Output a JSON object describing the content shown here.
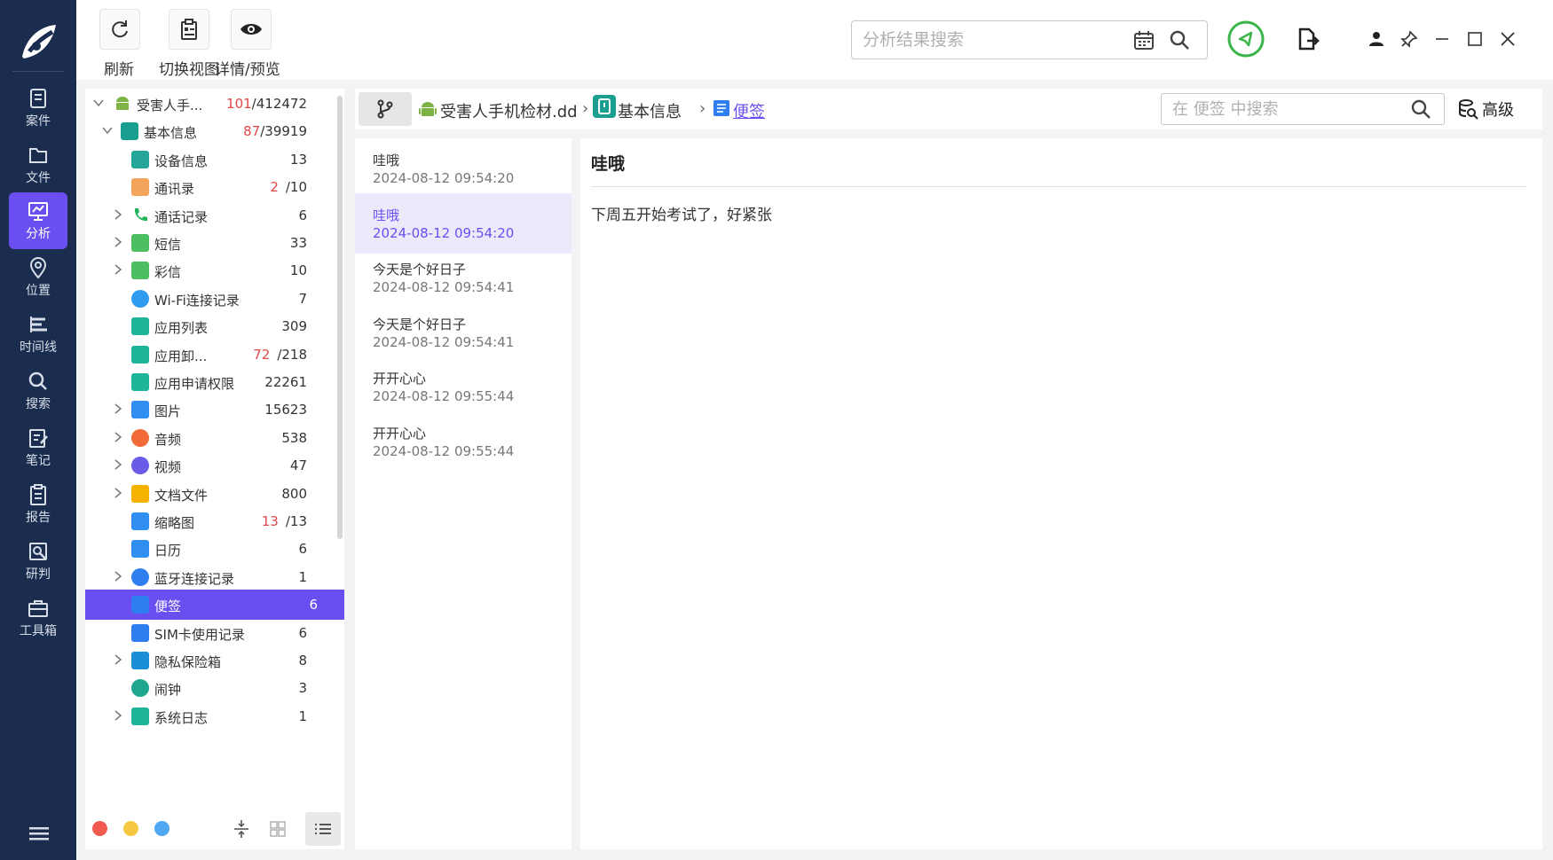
{
  "toolbar": {
    "refresh_label": "刷新",
    "switch_view_label": "切换视图",
    "details_label": "详情/预览",
    "search_placeholder": "分析结果搜索"
  },
  "nav": {
    "items": [
      {
        "label": "案件",
        "icon": "case-icon"
      },
      {
        "label": "文件",
        "icon": "folder-icon"
      },
      {
        "label": "分析",
        "icon": "analysis-icon",
        "active": true
      },
      {
        "label": "位置",
        "icon": "location-icon"
      },
      {
        "label": "时间线",
        "icon": "timeline-icon"
      },
      {
        "label": "搜索",
        "icon": "search-icon"
      },
      {
        "label": "笔记",
        "icon": "notes-icon"
      },
      {
        "label": "报告",
        "icon": "report-icon"
      },
      {
        "label": "研判",
        "icon": "judge-icon"
      },
      {
        "label": "工具箱",
        "icon": "toolbox-icon"
      }
    ]
  },
  "tree": {
    "rows": [
      {
        "name": "受害人手...",
        "red": "101",
        "total": "/412472",
        "icon": "android-icon",
        "color": "#7cb342"
      },
      {
        "name": "基本信息",
        "red": "87",
        "total": "/39919",
        "icon": "basic-info-icon",
        "color": "#1a9e8f"
      },
      {
        "name": "设备信息",
        "red": "",
        "total": "13",
        "icon": "device-info-icon",
        "color": "#26a69a"
      },
      {
        "name": "通讯录",
        "red": "2",
        "total": "/10",
        "icon": "contacts-icon",
        "color": "#f5a45b"
      },
      {
        "name": "通话记录",
        "red": "",
        "total": "6",
        "icon": "phone-icon",
        "color": "#21b35b"
      },
      {
        "name": "短信",
        "red": "",
        "total": "33",
        "icon": "sms-icon",
        "color": "#4cbf60"
      },
      {
        "name": "彩信",
        "red": "",
        "total": "10",
        "icon": "mms-icon",
        "color": "#4cbf60"
      },
      {
        "name": "Wi-Fi连接记录",
        "red": "",
        "total": "7",
        "icon": "wifi-icon",
        "color": "#2f9bf0"
      },
      {
        "name": "应用列表",
        "red": "",
        "total": "309",
        "icon": "app-list-icon",
        "color": "#1fb59a"
      },
      {
        "name": "应用卸...",
        "red": "72",
        "total": "/218",
        "icon": "app-uninstall-icon",
        "color": "#1fb59a"
      },
      {
        "name": "应用申请权限",
        "red": "",
        "total": "22261",
        "icon": "app-permission-icon",
        "color": "#1fb59a"
      },
      {
        "name": "图片",
        "red": "",
        "total": "15623",
        "icon": "image-icon",
        "color": "#2f8ef0"
      },
      {
        "name": "音频",
        "red": "",
        "total": "538",
        "icon": "audio-icon",
        "color": "#f06a3a"
      },
      {
        "name": "视频",
        "red": "",
        "total": "47",
        "icon": "video-icon",
        "color": "#6b5ce7"
      },
      {
        "name": "文档文件",
        "red": "",
        "total": "800",
        "icon": "document-icon",
        "color": "#f5b300"
      },
      {
        "name": "缩略图",
        "red": "13",
        "total": "/13",
        "icon": "thumbnail-icon",
        "color": "#2f8ef0"
      },
      {
        "name": "日历",
        "red": "",
        "total": "6",
        "icon": "calendar-icon",
        "color": "#2f8ef0"
      },
      {
        "name": "蓝牙连接记录",
        "red": "",
        "total": "1",
        "icon": "bluetooth-icon",
        "color": "#2f7ef0"
      },
      {
        "name": "便签",
        "red": "",
        "total": "6",
        "icon": "note-icon",
        "color": "#2f7ef0",
        "selected": true
      },
      {
        "name": "SIM卡使用记录",
        "red": "",
        "total": "6",
        "icon": "sim-icon",
        "color": "#2f7ef0"
      },
      {
        "name": "隐私保险箱",
        "red": "",
        "total": "8",
        "icon": "vault-icon",
        "color": "#1a8fd8"
      },
      {
        "name": "闹钟",
        "red": "",
        "total": "3",
        "icon": "alarm-icon",
        "color": "#1fa78f"
      },
      {
        "name": "系统日志",
        "red": "",
        "total": "1",
        "icon": "system-log-icon",
        "color": "#1fb59a"
      }
    ]
  },
  "breadcrumb": {
    "items": [
      "受害人手机检材.dd",
      "基本信息",
      "便签"
    ],
    "search_placeholder": "在 便签 中搜索",
    "advanced_label": "高级"
  },
  "list": {
    "items": [
      {
        "title": "哇哦",
        "date": "2024-08-12 09:54:20"
      },
      {
        "title": "哇哦",
        "date": "2024-08-12 09:54:20",
        "selected": true
      },
      {
        "title": "今天是个好日子",
        "date": "2024-08-12 09:54:41"
      },
      {
        "title": "今天是个好日子",
        "date": "2024-08-12 09:54:41"
      },
      {
        "title": "开开心心",
        "date": "2024-08-12 09:55:44"
      },
      {
        "title": "开开心心",
        "date": "2024-08-12 09:55:44"
      }
    ]
  },
  "detail": {
    "title": "哇哦",
    "body": "下周五开始考试了，好紧张"
  },
  "colors": {
    "accent": "#6b4ef0",
    "nav_bg": "#1a2d4f",
    "count_red": "#e04848",
    "status_green": "#3bb54a"
  }
}
